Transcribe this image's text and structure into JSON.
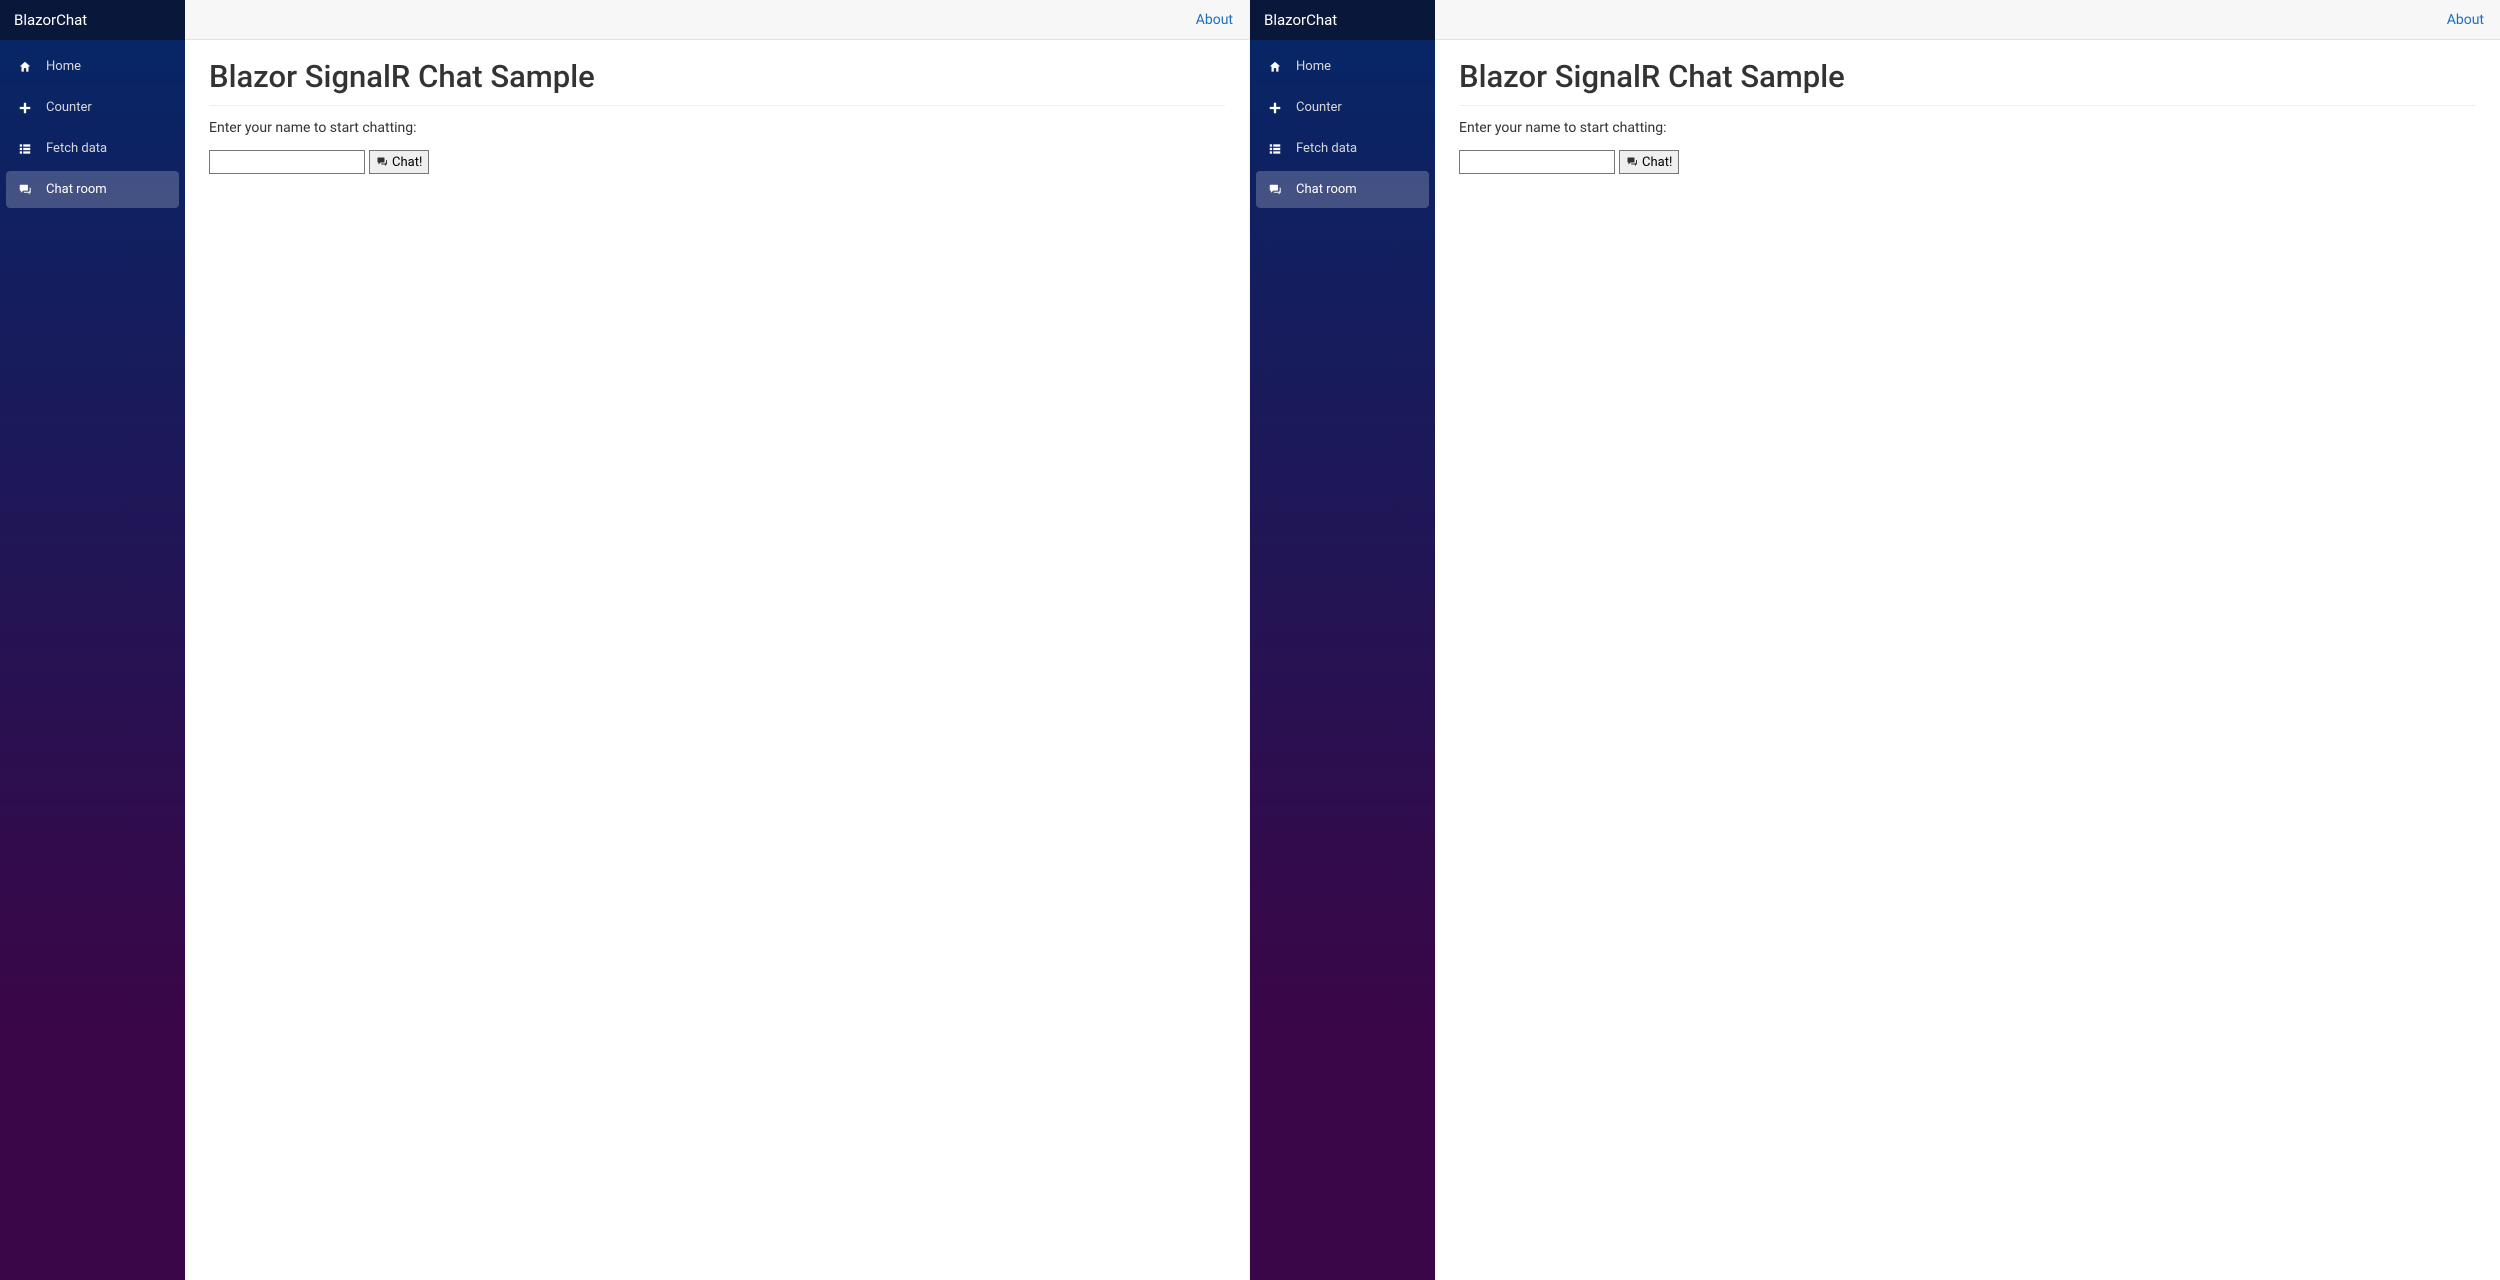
{
  "windows": [
    {
      "brand": "BlazorChat",
      "about_label": "About",
      "nav": {
        "items": [
          {
            "icon": "home",
            "label": "Home",
            "active": false
          },
          {
            "icon": "plus",
            "label": "Counter",
            "active": false
          },
          {
            "icon": "list",
            "label": "Fetch data",
            "active": false
          },
          {
            "icon": "chat",
            "label": "Chat room",
            "active": true
          }
        ]
      },
      "main": {
        "title": "Blazor SignalR Chat Sample",
        "prompt": "Enter your name to start chatting:",
        "name_value": "",
        "name_placeholder": "",
        "chat_button_label": "Chat!"
      }
    },
    {
      "brand": "BlazorChat",
      "about_label": "About",
      "nav": {
        "items": [
          {
            "icon": "home",
            "label": "Home",
            "active": false
          },
          {
            "icon": "plus",
            "label": "Counter",
            "active": false
          },
          {
            "icon": "list",
            "label": "Fetch data",
            "active": false
          },
          {
            "icon": "chat",
            "label": "Chat room",
            "active": true
          }
        ]
      },
      "main": {
        "title": "Blazor SignalR Chat Sample",
        "prompt": "Enter your name to start chatting:",
        "name_value": "",
        "name_placeholder": "",
        "chat_button_label": "Chat!"
      }
    }
  ]
}
